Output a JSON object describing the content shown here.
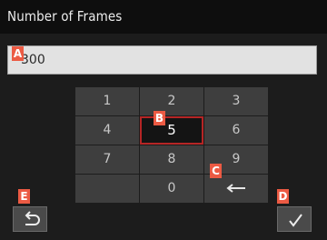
{
  "title": "Number of Frames",
  "entry": {
    "value": "300"
  },
  "keypad": {
    "keys": [
      "1",
      "2",
      "3",
      "4",
      "5",
      "6",
      "7",
      "8",
      "9",
      "",
      "0",
      "←"
    ],
    "selected_key": "5",
    "backspace_icon": "left-arrow-icon"
  },
  "buttons": {
    "back_icon": "undo-arrow-icon",
    "confirm_icon": "checkmark-icon"
  },
  "markers": {
    "a": "A",
    "b": "B",
    "c": "C",
    "d": "D",
    "e": "E"
  },
  "colors": {
    "marker": "#ec5a43",
    "selection_border": "#b52525",
    "key_background": "#3e3e3e",
    "entry_background": "#e2e2e2"
  }
}
